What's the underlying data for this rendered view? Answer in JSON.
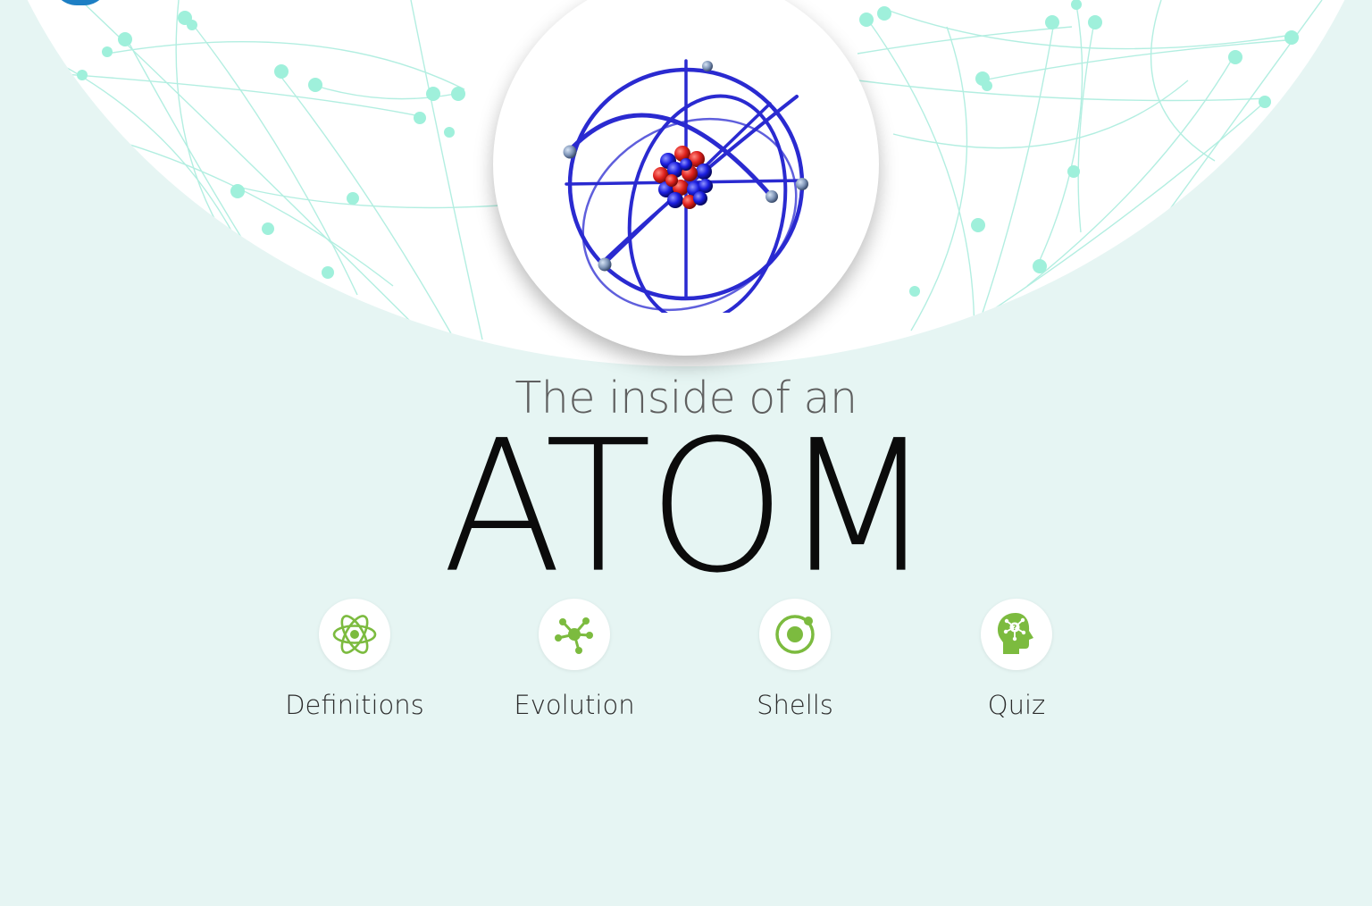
{
  "header": {
    "subtitle": "The inside of an",
    "title": "ATOM"
  },
  "hero": {
    "image": "atom-model-icon"
  },
  "nav": {
    "items": [
      {
        "label": "Definitions",
        "icon": "atom-icon"
      },
      {
        "label": "Evolution",
        "icon": "molecule-network-icon"
      },
      {
        "label": "Shells",
        "icon": "electron-shell-icon"
      },
      {
        "label": "Quiz",
        "icon": "head-question-icon"
      }
    ]
  },
  "colors": {
    "background": "#e6f5f3",
    "accent_green": "#7cbb3f",
    "network_lines": "#8fe6d3",
    "orbit_blue": "#2a2ad0",
    "proton_red": "#e0221e",
    "neutron_blue": "#1b1ee0",
    "badge_blue": "#1d7fc4"
  }
}
